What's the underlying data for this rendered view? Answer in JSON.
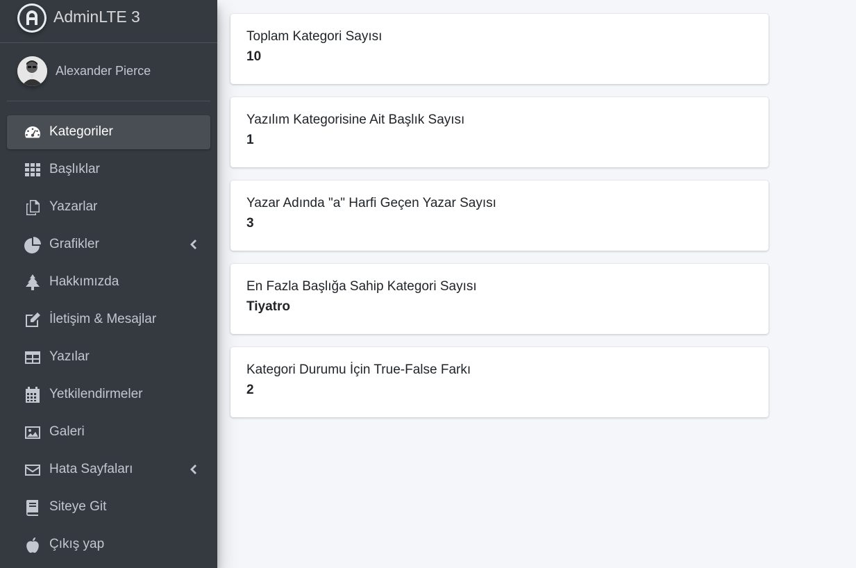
{
  "brand": {
    "title": "AdminLTE 3"
  },
  "user": {
    "name": "Alexander Pierce"
  },
  "nav": [
    {
      "label": "Kategoriler",
      "icon": "tachometer-icon",
      "active": true
    },
    {
      "label": "Başlıklar",
      "icon": "grid-icon"
    },
    {
      "label": "Yazarlar",
      "icon": "copy-icon"
    },
    {
      "label": "Grafikler",
      "icon": "pie-chart-icon",
      "has_arrow": true
    },
    {
      "label": "Hakkımızda",
      "icon": "tree-icon"
    },
    {
      "label": "İletişim & Mesajlar",
      "icon": "edit-icon"
    },
    {
      "label": "Yazılar",
      "icon": "table-icon"
    },
    {
      "label": "Yetkilendirmeler",
      "icon": "calendar-icon"
    },
    {
      "label": "Galeri",
      "icon": "image-icon"
    },
    {
      "label": "Hata Sayfaları",
      "icon": "envelope-icon",
      "has_arrow": true
    },
    {
      "label": "Siteye Git",
      "icon": "book-icon"
    },
    {
      "label": "Çıkış yap",
      "icon": "apple-icon"
    }
  ],
  "stats": [
    {
      "label": "Toplam Kategori Sayısı",
      "value": "10"
    },
    {
      "label": "Yazılım Kategorisine Ait Başlık Sayısı",
      "value": "1"
    },
    {
      "label": "Yazar Adında \"a\" Harfi Geçen Yazar Sayısı",
      "value": "3"
    },
    {
      "label": "En Fazla Başlığa Sahip Kategori Sayısı",
      "value": "Tiyatro"
    },
    {
      "label": "Kategori Durumu İçin True-False Farkı",
      "value": "2"
    }
  ],
  "colors": {
    "sidebar_bg": "#343a40",
    "content_bg": "#f4f6f9",
    "card_bg": "#ffffff",
    "nav_text": "#c2c7d0"
  }
}
